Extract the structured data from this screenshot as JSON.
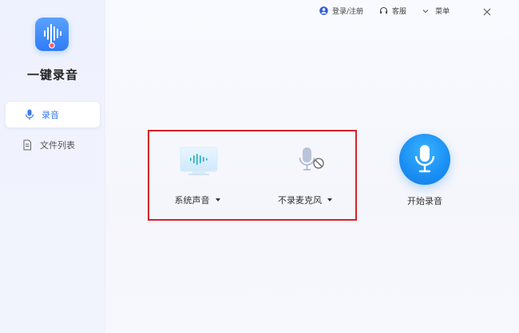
{
  "app": {
    "name": "一键录音",
    "logo_icon": "waveform-icon",
    "brand_color": "#2f7cf6"
  },
  "topbar": {
    "login_label": "登录/注册",
    "service_label": "客服",
    "menu_label": "菜单"
  },
  "sidebar": {
    "items": [
      {
        "label": "录音",
        "icon": "microphone-icon",
        "active": true
      },
      {
        "label": "文件列表",
        "icon": "document-icon",
        "active": false
      }
    ]
  },
  "main": {
    "sources": [
      {
        "label": "系统声音",
        "icon": "monitor-audio-icon"
      },
      {
        "label": "不录麦克风",
        "icon": "microphone-muted-icon"
      }
    ],
    "record_button_label": "开始录音",
    "highlight_color": "#d32029"
  }
}
